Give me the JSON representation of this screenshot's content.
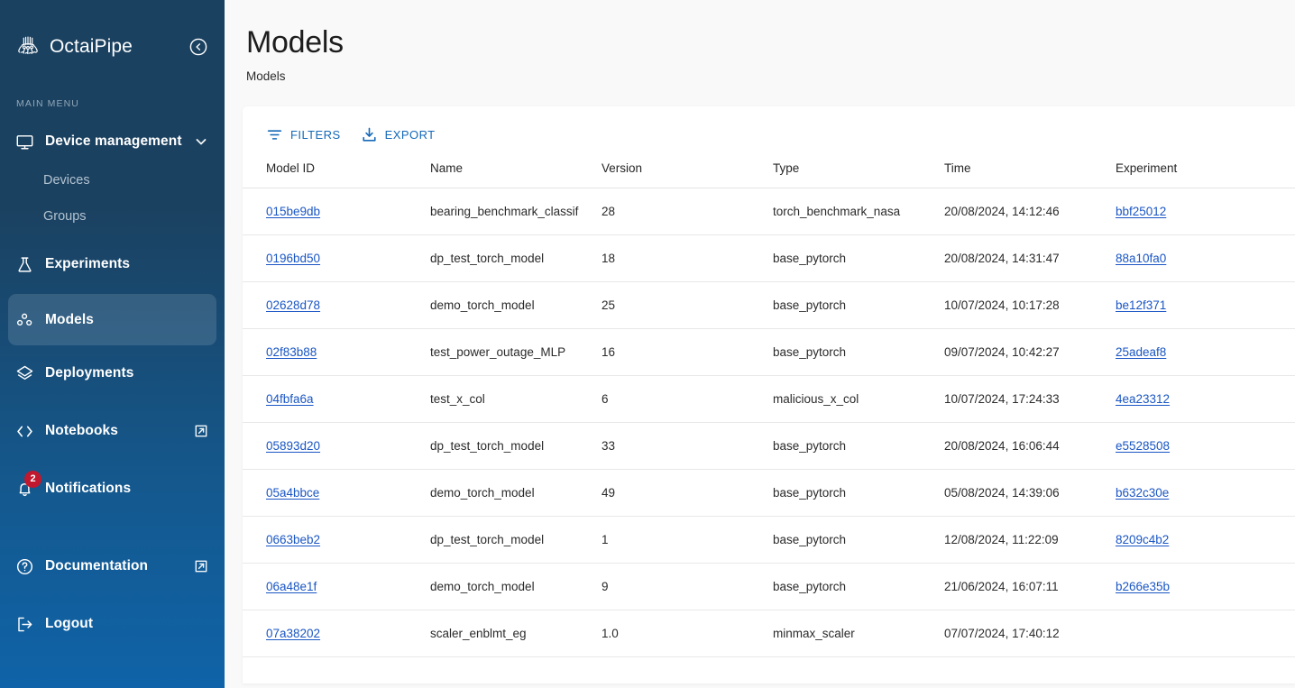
{
  "sidebar": {
    "brand": {
      "name": "OctaiPipe",
      "logo_icon": "octopus-logo-icon"
    },
    "collapse_icon": "collapse-left-circle-icon",
    "section_label": "MAIN MENU",
    "items": [
      {
        "label": "Device management",
        "icon": "monitor-icon",
        "trailing_icon": "chevron-down-icon",
        "type": "parent",
        "active": false
      },
      {
        "label": "Devices",
        "icon": "",
        "type": "sub",
        "active": false
      },
      {
        "label": "Groups",
        "icon": "",
        "type": "sub",
        "active": false
      },
      {
        "label": "Experiments",
        "icon": "flask-icon",
        "type": "item",
        "active": false
      },
      {
        "label": "Models",
        "icon": "models-dots-icon",
        "type": "item",
        "active": true
      },
      {
        "label": "Deployments",
        "icon": "layers-icon",
        "type": "item",
        "active": false
      },
      {
        "label": "Notebooks",
        "icon": "code-brackets-icon",
        "trailing_icon": "external-link-icon",
        "type": "item",
        "active": false
      },
      {
        "label": "Notifications",
        "icon": "bell-icon",
        "badge": "2",
        "type": "item",
        "active": false
      },
      {
        "label": "Documentation",
        "icon": "question-circle-icon",
        "trailing_icon": "external-link-icon",
        "type": "item",
        "active": false
      },
      {
        "label": "Logout",
        "icon": "logout-icon",
        "type": "item",
        "active": false
      }
    ],
    "colors": {
      "top": "#1b4160",
      "bottom": "#0f63a8",
      "badge": "#c0182f",
      "active_overlay": "rgba(255,255,255,0.13)"
    }
  },
  "header": {
    "title": "Models",
    "breadcrumb": "Models"
  },
  "toolbar": {
    "filters_label": "FILTERS",
    "filters_icon": "filter-funnel-icon",
    "export_label": "EXPORT",
    "export_icon": "download-tray-icon",
    "accent_color": "#1569b8"
  },
  "table": {
    "columns": [
      "Model ID",
      "Name",
      "Version",
      "Type",
      "Time",
      "Experiment"
    ],
    "link_color": "#1a56c4",
    "rows": [
      {
        "model_id": "015be9db",
        "name": "bearing_benchmark_classif",
        "version": "28",
        "type": "torch_benchmark_nasa",
        "time": "20/08/2024, 14:12:46",
        "experiment": "bbf25012"
      },
      {
        "model_id": "0196bd50",
        "name": "dp_test_torch_model",
        "version": "18",
        "type": "base_pytorch",
        "time": "20/08/2024, 14:31:47",
        "experiment": "88a10fa0"
      },
      {
        "model_id": "02628d78",
        "name": "demo_torch_model",
        "version": "25",
        "type": "base_pytorch",
        "time": "10/07/2024, 10:17:28",
        "experiment": "be12f371"
      },
      {
        "model_id": "02f83b88",
        "name": "test_power_outage_MLP",
        "version": "16",
        "type": "base_pytorch",
        "time": "09/07/2024, 10:42:27",
        "experiment": "25adeaf8"
      },
      {
        "model_id": "04fbfa6a",
        "name": "test_x_col",
        "version": "6",
        "type": "malicious_x_col",
        "time": "10/07/2024, 17:24:33",
        "experiment": "4ea23312"
      },
      {
        "model_id": "05893d20",
        "name": "dp_test_torch_model",
        "version": "33",
        "type": "base_pytorch",
        "time": "20/08/2024, 16:06:44",
        "experiment": "e5528508"
      },
      {
        "model_id": "05a4bbce",
        "name": "demo_torch_model",
        "version": "49",
        "type": "base_pytorch",
        "time": "05/08/2024, 14:39:06",
        "experiment": "b632c30e"
      },
      {
        "model_id": "0663beb2",
        "name": "dp_test_torch_model",
        "version": "1",
        "type": "base_pytorch",
        "time": "12/08/2024, 11:22:09",
        "experiment": "8209c4b2"
      },
      {
        "model_id": "06a48e1f",
        "name": "demo_torch_model",
        "version": "9",
        "type": "base_pytorch",
        "time": "21/06/2024, 16:07:11",
        "experiment": "b266e35b"
      },
      {
        "model_id": "07a38202",
        "name": "scaler_enblmt_eg",
        "version": "1.0",
        "type": "minmax_scaler",
        "time": "07/07/2024, 17:40:12",
        "experiment": ""
      }
    ]
  }
}
